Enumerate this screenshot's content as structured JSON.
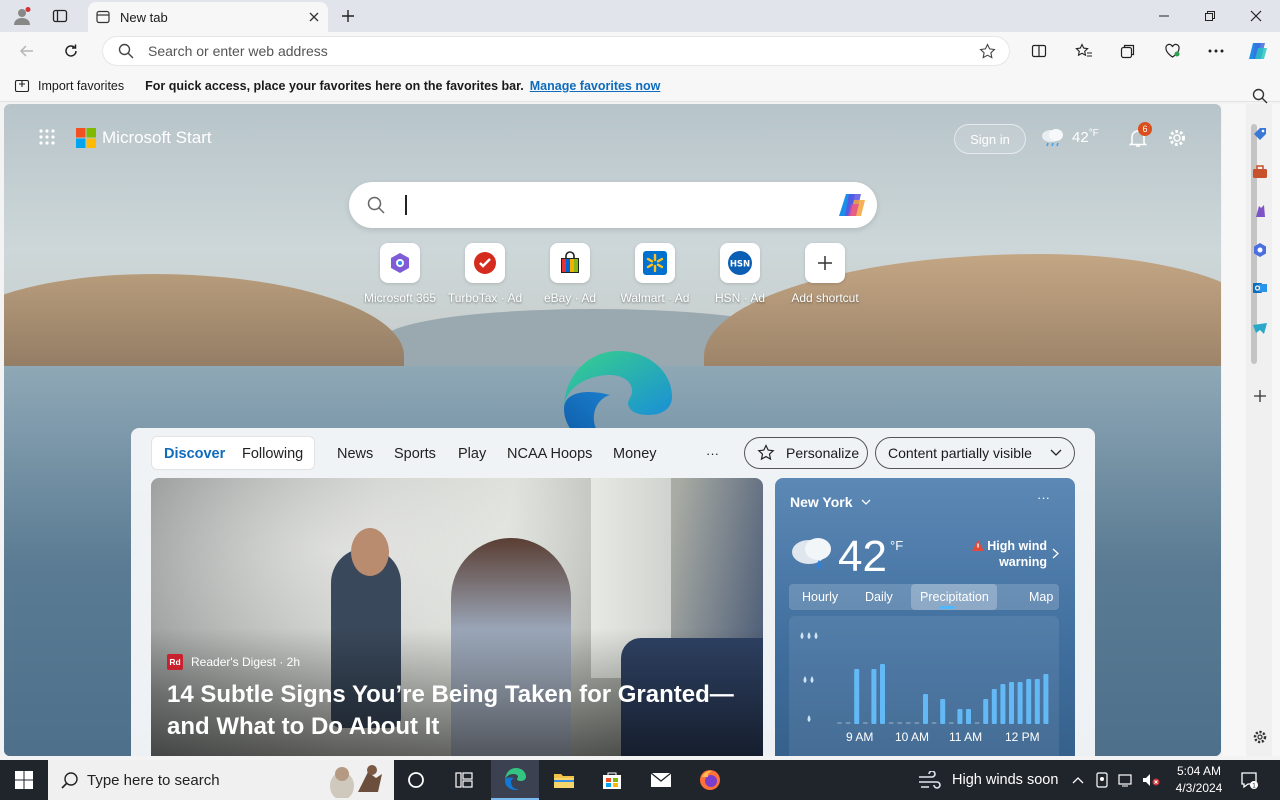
{
  "browser": {
    "tab_title": "New tab",
    "address_placeholder": "Search or enter web address",
    "favorites": {
      "import_label": "Import favorites",
      "hint": "For quick access, place your favorites here on the favorites bar.",
      "manage_link": "Manage favorites now"
    }
  },
  "start": {
    "brand": "Microsoft Start",
    "sign_in": "Sign in",
    "temp": "42",
    "temp_unit": "°F",
    "notification_count": "6"
  },
  "shortcuts": [
    {
      "label": "Microsoft 365"
    },
    {
      "label": "TurboTax · Ad"
    },
    {
      "label": "eBay · Ad"
    },
    {
      "label": "Walmart · Ad"
    },
    {
      "label": "HSN · Ad"
    },
    {
      "label": "Add shortcut"
    }
  ],
  "feed": {
    "tabs": [
      "Discover",
      "Following",
      "News",
      "Sports",
      "Play",
      "NCAA Hoops",
      "Money"
    ],
    "more": "···",
    "personalize": "Personalize",
    "content_visibility": "Content partially visible",
    "hero": {
      "source": "Reader's Digest · 2h",
      "source_logo": "Rd",
      "headline": "14 Subtle Signs You’re Being Taken for Granted—and What to Do About It"
    }
  },
  "weather": {
    "location": "New York",
    "temp": "42",
    "unit": "°F",
    "alert_line1": "High wind",
    "alert_line2": "warning",
    "tabs": [
      "Hourly",
      "Daily",
      "Precipitation",
      "Map"
    ],
    "times": [
      "9 AM",
      "10 AM",
      "11 AM",
      "12 PM"
    ],
    "precip_levels": [
      0,
      0,
      0.55,
      0,
      0.55,
      0.6,
      0,
      0,
      0,
      0,
      0.3,
      0,
      0.25,
      0,
      0.15,
      0.15,
      0,
      0.25,
      0.35,
      0.4,
      0.42,
      0.42,
      0.45,
      0.45,
      0.5
    ]
  },
  "taskbar": {
    "search_placeholder": "Type here to search",
    "weather_status": "High winds soon",
    "time": "5:04 AM",
    "date": "4/3/2024"
  },
  "colors": {
    "accent": "#0f6cbd",
    "link": "#0f6cbd",
    "badge": "#d94f1e"
  }
}
